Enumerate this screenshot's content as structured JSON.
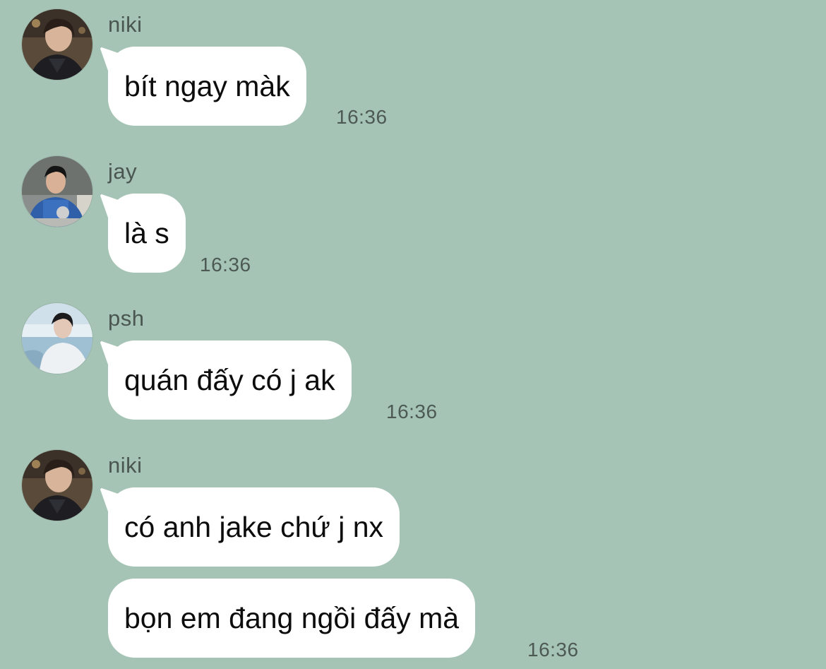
{
  "messages": [
    {
      "sender": "niki",
      "avatar_icon": "niki-avatar",
      "bubbles": [
        "bít ngay màk"
      ],
      "time": "16:36"
    },
    {
      "sender": "jay",
      "avatar_icon": "jay-avatar",
      "bubbles": [
        "là s"
      ],
      "time": "16:36"
    },
    {
      "sender": "psh",
      "avatar_icon": "psh-avatar",
      "bubbles": [
        "quán đấy có j ak"
      ],
      "time": "16:36"
    },
    {
      "sender": "niki",
      "avatar_icon": "niki-avatar",
      "bubbles": [
        "có anh jake chứ j nx",
        "bọn em đang ngồi đấy mà"
      ],
      "time": "16:36"
    }
  ],
  "colors": {
    "background": "#a6c4b6",
    "bubble": "#ffffff",
    "sender_text": "#4a5650",
    "time_text": "#4d5a54"
  }
}
